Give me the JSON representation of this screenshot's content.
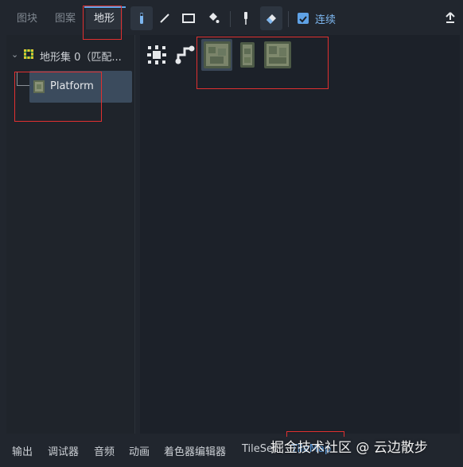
{
  "tabs": [
    {
      "label": "图块",
      "active": false
    },
    {
      "label": "图案",
      "active": false
    },
    {
      "label": "地形",
      "active": true
    }
  ],
  "toolbar": {
    "tools": [
      {
        "icon": "select-pointer-icon",
        "pressed": true
      },
      {
        "icon": "line-icon",
        "pressed": false
      },
      {
        "icon": "rectangle-icon",
        "pressed": false
      },
      {
        "icon": "bucket-fill-icon",
        "pressed": false
      },
      {
        "icon": "picker-icon",
        "pressed": false
      },
      {
        "icon": "eraser-icon",
        "pressed": true
      }
    ],
    "continuous_label": "连续",
    "continuous_checked": true
  },
  "terrain_tree": {
    "set_label": "地形集 0（匹配...",
    "items": [
      {
        "label": "Platform",
        "selected": true
      }
    ]
  },
  "terrain_modes": [
    "connect-mode-icon",
    "path-mode-icon"
  ],
  "tiles": [
    "tile-wide-stone",
    "tile-narrow-stone",
    "tile-corner-stone"
  ],
  "bottom_tabs": [
    "输出",
    "调试器",
    "音频",
    "动画",
    "着色器编辑器",
    "TileSet",
    "TileMap"
  ],
  "watermark": "掘金技术社区 @ 云边散步",
  "colors": {
    "accent": "#5fa2e6",
    "highlight": "#e03030",
    "selection": "#3b4b5d"
  }
}
